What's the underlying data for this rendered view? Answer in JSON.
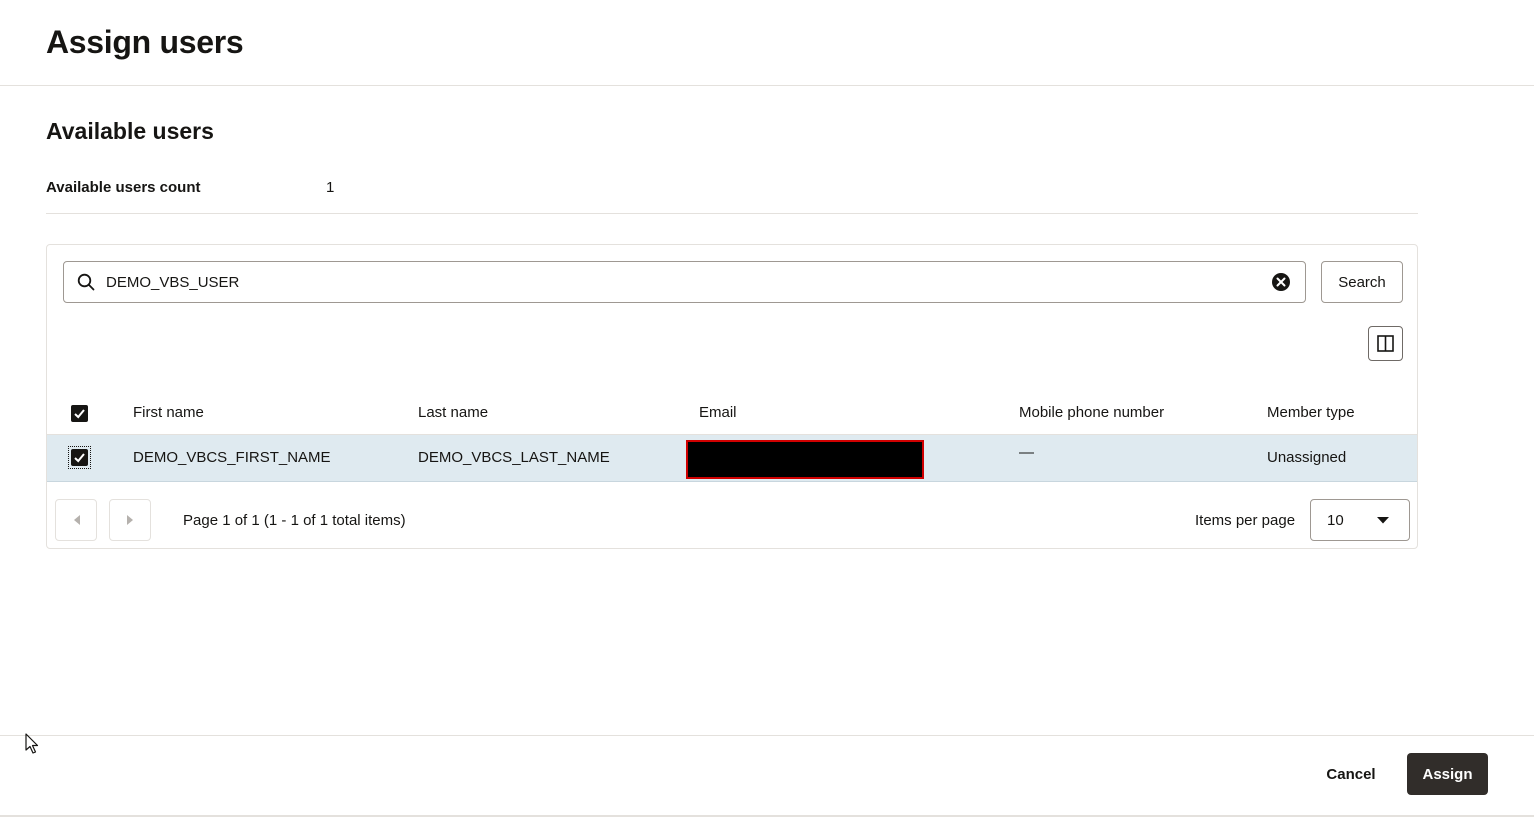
{
  "header": {
    "title": "Assign users"
  },
  "section": {
    "title": "Available users"
  },
  "summary": {
    "count_label": "Available users count",
    "count_value": "1"
  },
  "search": {
    "value": "DEMO_VBS_USER",
    "button_label": "Search"
  },
  "table": {
    "columns": [
      "First name",
      "Last name",
      "Email",
      "Mobile phone number",
      "Member type"
    ],
    "rows": [
      {
        "first_name": "DEMO_VBCS_FIRST_NAME",
        "last_name": "DEMO_VBCS_LAST_NAME",
        "email": "",
        "mobile": "—",
        "member_type": "Unassigned",
        "selected": true
      }
    ]
  },
  "pagination": {
    "info": "Page 1 of 1 (1 - 1 of 1 total items)",
    "items_per_page_label": "Items per page",
    "items_per_page_value": "10"
  },
  "footer": {
    "cancel_label": "Cancel",
    "assign_label": "Assign"
  },
  "icons": [
    "search-icon",
    "clear-icon",
    "columns-icon",
    "checkbox-checked-icon",
    "chevron-left-icon",
    "chevron-right-icon",
    "caret-down-icon",
    "mouse-cursor-icon"
  ],
  "colors": {
    "primary_button": "#312d2a",
    "row_selected": "#dfeaf0",
    "redaction_border": "#d00000"
  }
}
